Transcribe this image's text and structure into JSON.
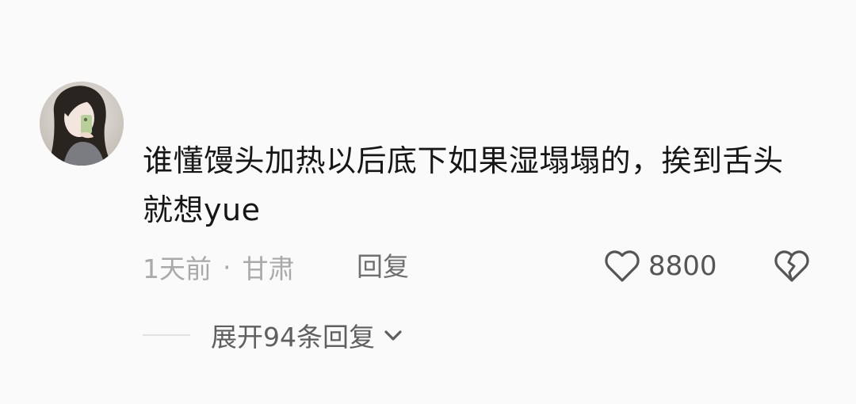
{
  "comment": {
    "avatar_icon": "user-avatar-photo",
    "text": "谁懂馒头加热以后底下如果湿塌塌的，挨到舌头就想yue",
    "time": "1天前",
    "separator": "·",
    "location": "甘肃",
    "reply_label": "回复",
    "like_icon": "heart-outline-icon",
    "like_count": "8800",
    "dislike_icon": "broken-heart-icon"
  },
  "replies": {
    "expand_label": "展开94条回复",
    "expand_icon": "chevron-down-icon"
  },
  "colors": {
    "background": "#fafafa",
    "primary_text": "#161616",
    "secondary_text": "#a9a9a9",
    "action_text": "#6f6f6f"
  }
}
